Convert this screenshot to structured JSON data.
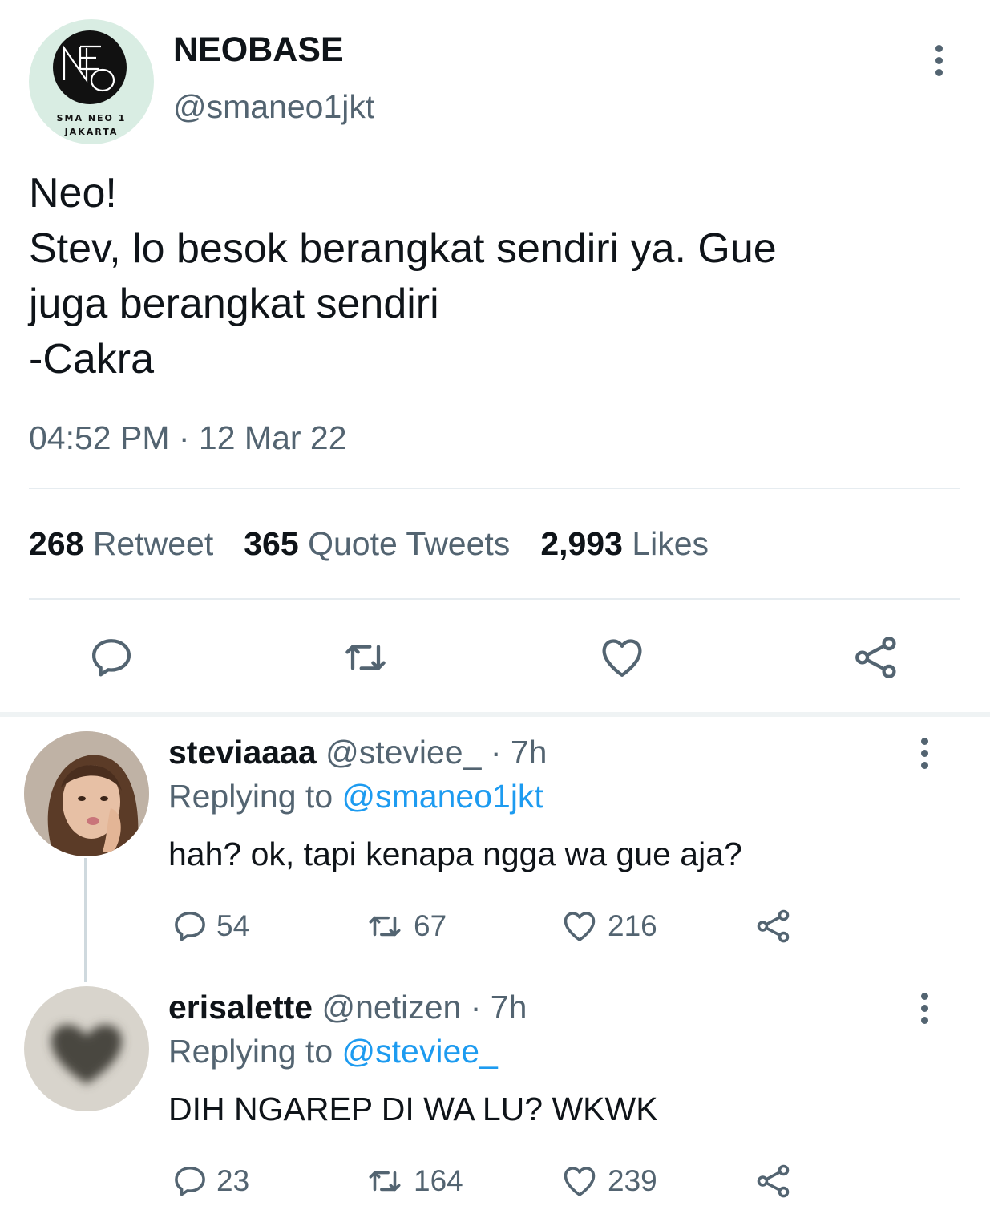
{
  "tweet": {
    "author_name": "NEOBASE",
    "author_handle": "@smaneo1jkt",
    "avatar_logo_text": "NEO",
    "avatar_caption_line1": "SMA NEO 1",
    "avatar_caption_line2": "JAKARTA",
    "text_lines": [
      "Neo!",
      "Stev, lo besok berangkat sendiri ya. Gue",
      "juga berangkat sendiri",
      "-Cakra"
    ],
    "timestamp": "04:52 PM · 12 Mar 22",
    "stats": {
      "retweets": "268",
      "retweets_label": "Retweet",
      "quotes": "365",
      "quotes_label": "Quote Tweets",
      "likes": "2,993",
      "likes_label": "Likes"
    }
  },
  "replies": [
    {
      "name": "steviaaaa",
      "handle": "@steviee_",
      "time": "· 7h",
      "replying_label": "Replying to",
      "replying_to": "@smaneo1jkt",
      "text": "hah? ok, tapi kenapa ngga wa gue aja?",
      "replies": "54",
      "retweets": "67",
      "likes": "216"
    },
    {
      "name": "erisalette",
      "handle": "@netizen",
      "time": "· 7h",
      "replying_label": "Replying to",
      "replying_to": "@steviee_",
      "text": "DIH NGAREP DI WA LU? WKWK",
      "replies": "23",
      "retweets": "164",
      "likes": "239"
    }
  ],
  "colors": {
    "text_primary": "#0f1419",
    "text_secondary": "#536471",
    "link_blue": "#1d9bf0",
    "divider": "#e6ecf0"
  },
  "icons": [
    "reply-icon",
    "retweet-icon",
    "like-icon",
    "share-icon",
    "more-icon"
  ]
}
